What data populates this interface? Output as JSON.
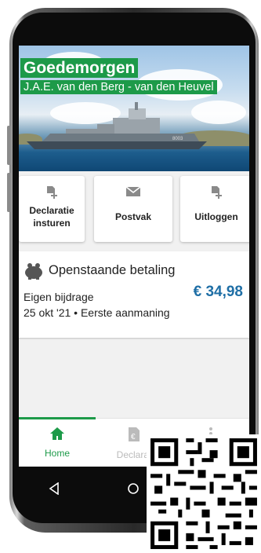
{
  "hero": {
    "greeting": "Goedemorgen",
    "user_name": "J.A.E. van den Berg - van den Heuvel",
    "ship_number": "8003"
  },
  "actions": [
    {
      "label": "Declaratie insturen",
      "icon": "document-plus-icon"
    },
    {
      "label": "Postvak",
      "icon": "envelope-icon"
    },
    {
      "label": "Uitloggen",
      "icon": "logout-document-icon"
    }
  ],
  "payment": {
    "title": "Openstaande betaling",
    "description": "Eigen bijdrage",
    "date_status": "25 okt '21 • Eerste aanmaning",
    "amount": "€ 34,98",
    "icon": "piggy-bank-icon"
  },
  "bottom_nav": {
    "items": [
      {
        "label": "Home",
        "icon": "home-icon",
        "active": true
      },
      {
        "label": "Declarat",
        "icon": "euro-document-icon",
        "active": false
      },
      {
        "label": "",
        "icon": "more-vertical-icon",
        "active": false
      }
    ]
  },
  "colors": {
    "brand_green": "#1d9a49",
    "amount_blue": "#1f6fa6",
    "inactive_gray": "#bbbbbb"
  }
}
